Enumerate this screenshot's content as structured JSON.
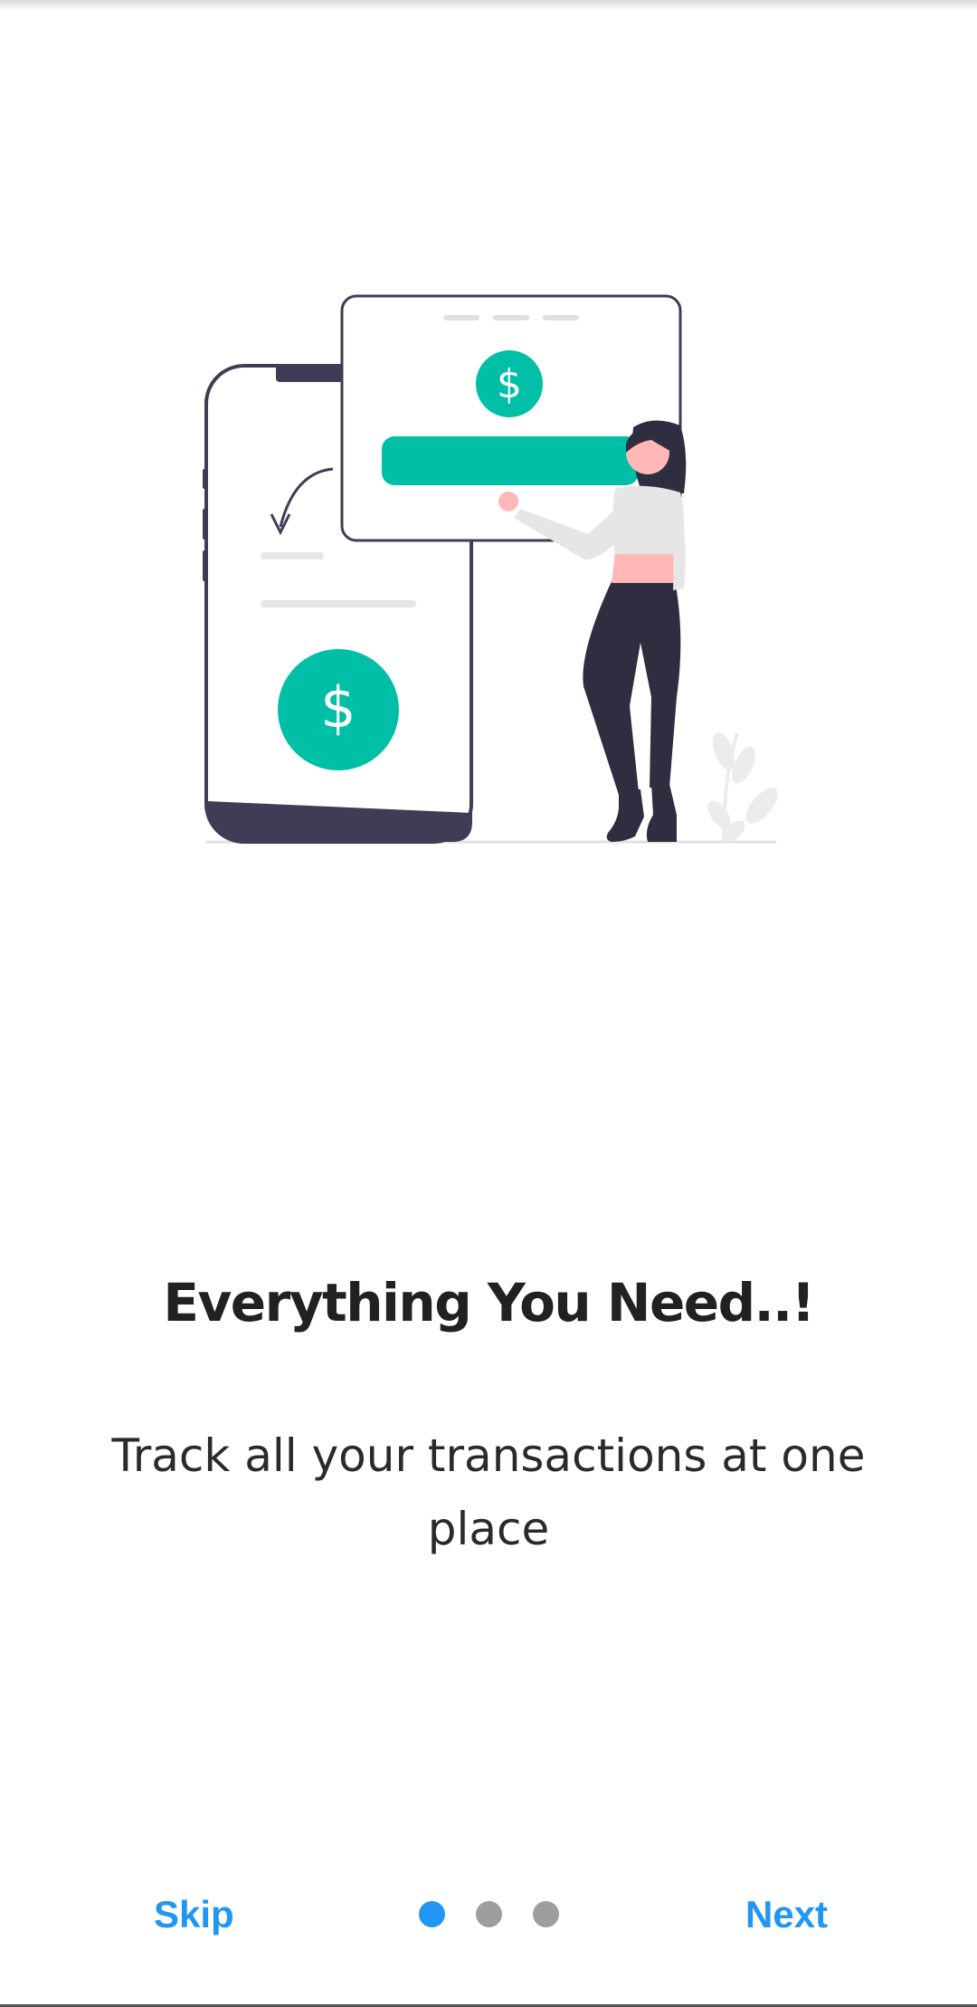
{
  "onboarding": {
    "title": "Everything You Need..!",
    "subtitle": "Track all your transactions at one place",
    "skip_label": "Skip",
    "next_label": "Next",
    "current_page": 1,
    "total_pages": 3
  },
  "illustration": {
    "icon": "payment-illustration",
    "currency_symbol": "$"
  },
  "colors": {
    "accent": "#2196f3",
    "illustration_green": "#00bfa6",
    "dark_navy": "#3f3d56",
    "inactive_dot": "#9e9e9e",
    "text": "#212121"
  }
}
